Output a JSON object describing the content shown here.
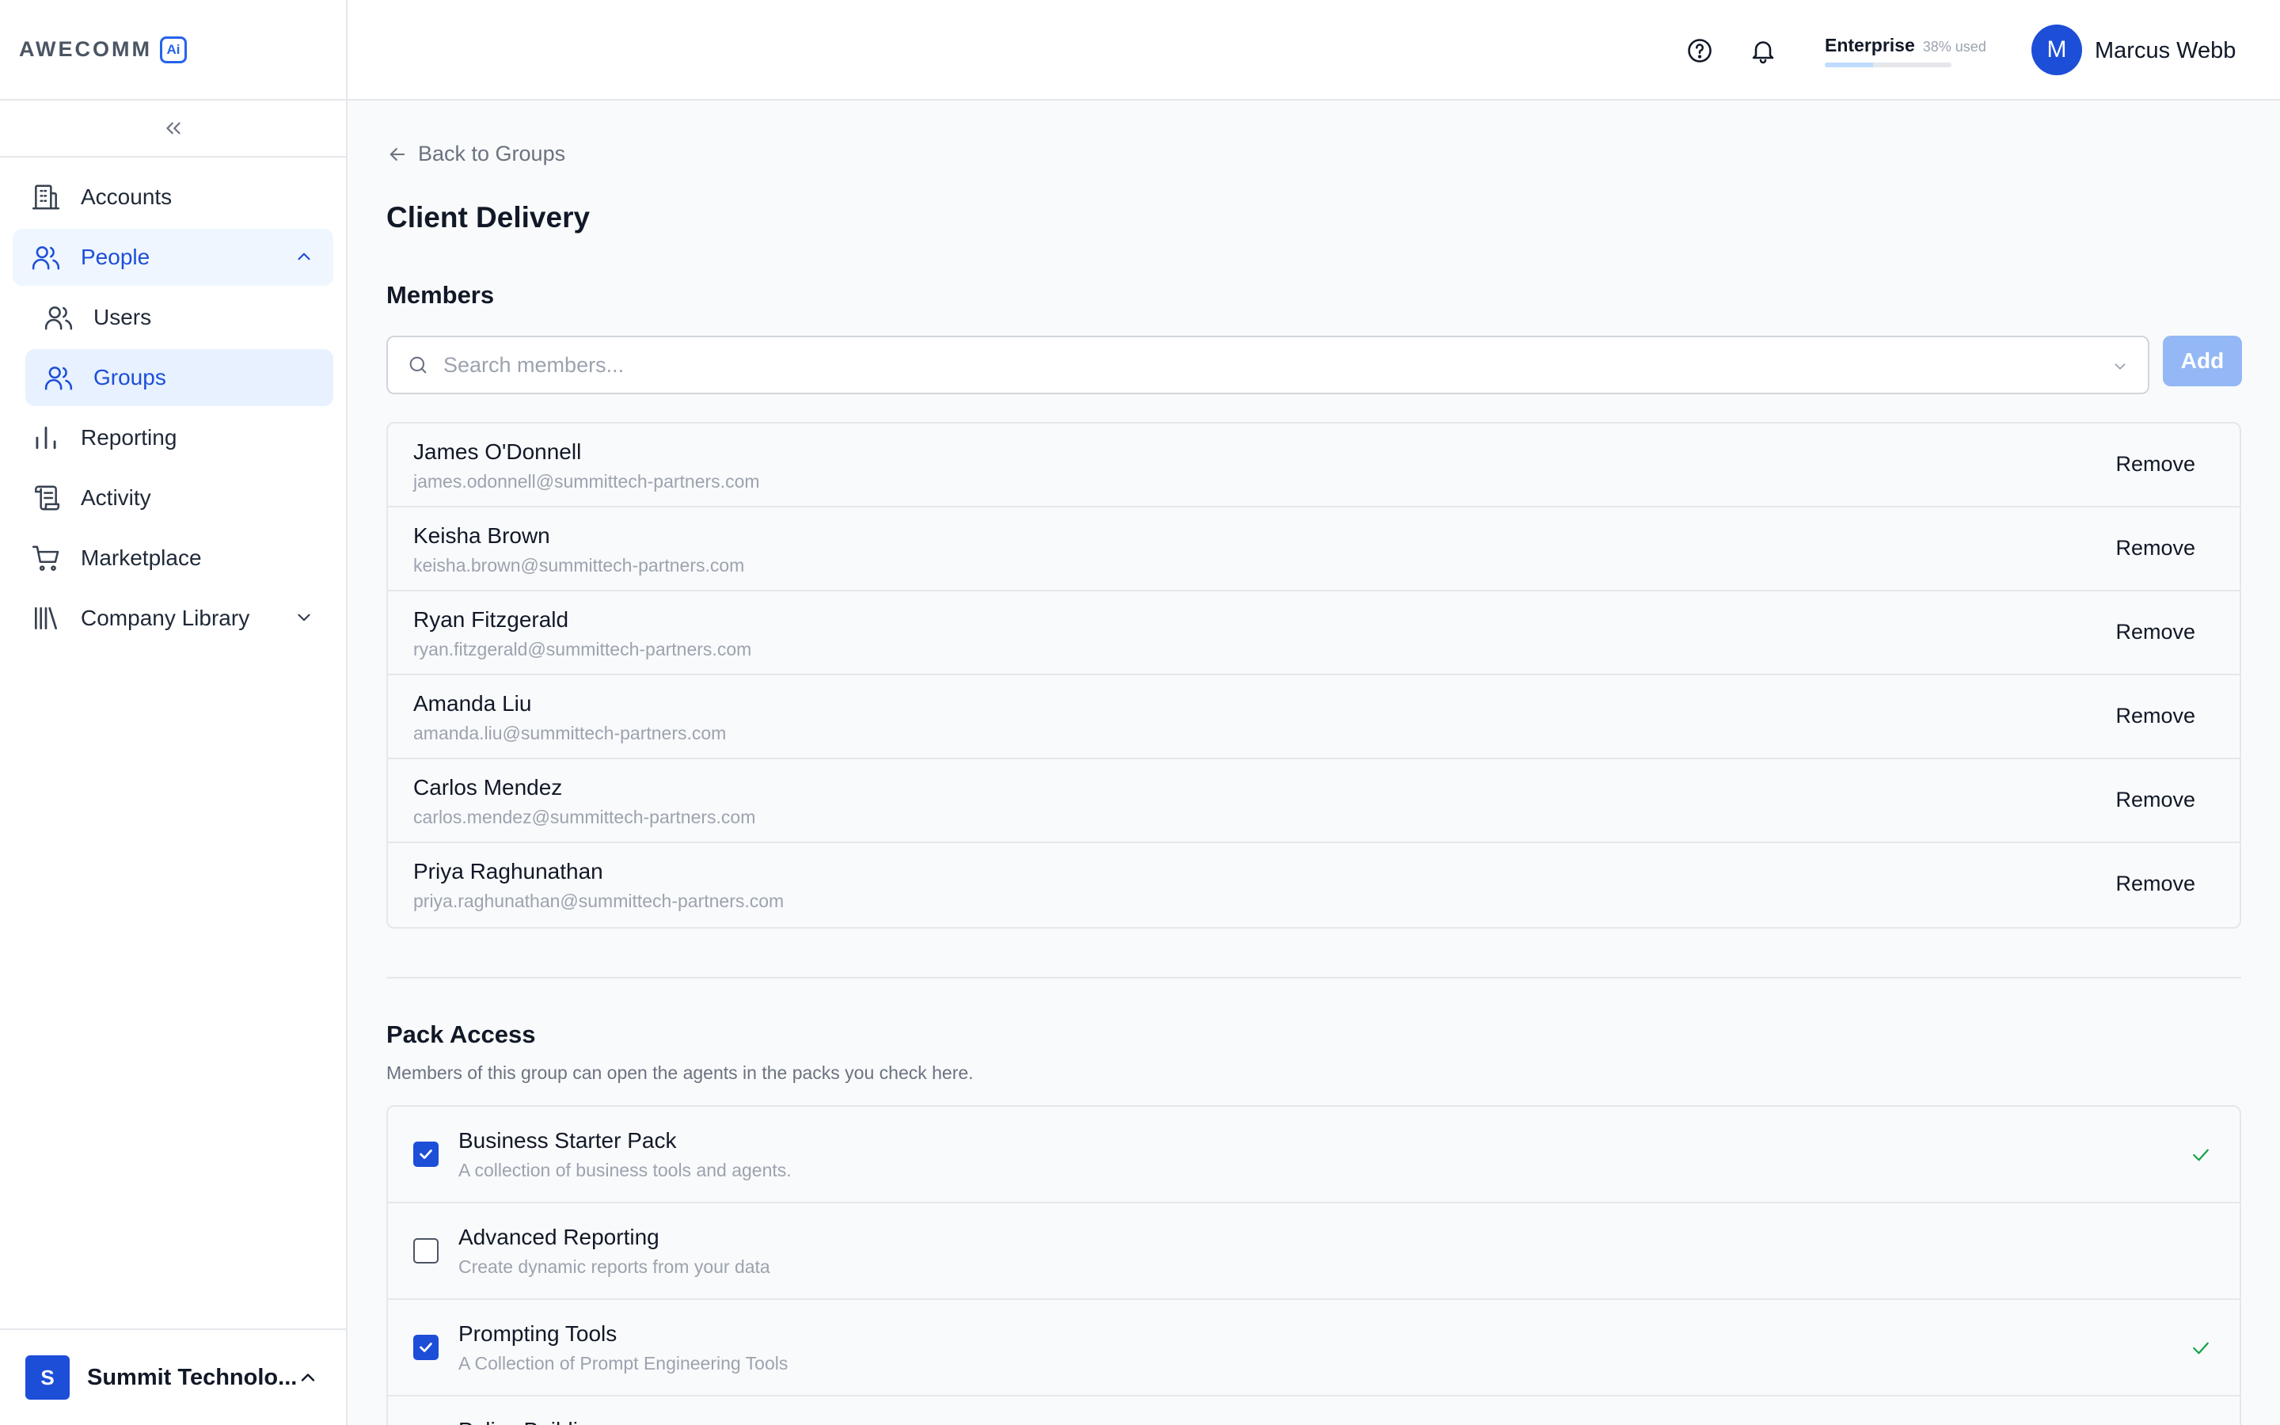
{
  "brand": {
    "name": "AWECOMM",
    "badge": "Ai"
  },
  "sidebar": {
    "items": [
      {
        "label": "Accounts"
      },
      {
        "label": "People"
      },
      {
        "label": "Users"
      },
      {
        "label": "Groups"
      },
      {
        "label": "Reporting"
      },
      {
        "label": "Activity"
      },
      {
        "label": "Marketplace"
      },
      {
        "label": "Company Library"
      }
    ],
    "org": {
      "initial": "S",
      "name": "Summit Technolo..."
    }
  },
  "header": {
    "plan": {
      "name": "Enterprise",
      "usage_text": "38% used",
      "usage_fraction": 0.38
    },
    "user": {
      "initial": "M",
      "name": "Marcus Webb"
    }
  },
  "main": {
    "back_label": "Back to Groups",
    "title": "Client Delivery",
    "members": {
      "title": "Members",
      "search_placeholder": "Search members...",
      "add_label": "Add",
      "remove_label": "Remove",
      "list": [
        {
          "name": "James O'Donnell",
          "email": "james.odonnell@summittech-partners.com"
        },
        {
          "name": "Keisha Brown",
          "email": "keisha.brown@summittech-partners.com"
        },
        {
          "name": "Ryan Fitzgerald",
          "email": "ryan.fitzgerald@summittech-partners.com"
        },
        {
          "name": "Amanda Liu",
          "email": "amanda.liu@summittech-partners.com"
        },
        {
          "name": "Carlos Mendez",
          "email": "carlos.mendez@summittech-partners.com"
        },
        {
          "name": "Priya Raghunathan",
          "email": "priya.raghunathan@summittech-partners.com"
        }
      ]
    },
    "pack_access": {
      "title": "Pack Access",
      "description": "Members of this group can open the agents in the packs you check here.",
      "packs": [
        {
          "name": "Business Starter Pack",
          "description": "A collection of business tools and agents.",
          "checked": true
        },
        {
          "name": "Advanced Reporting",
          "description": "Create dynamic reports from your data",
          "checked": false
        },
        {
          "name": "Prompting Tools",
          "description": "A Collection of Prompt Engineering Tools",
          "checked": true
        },
        {
          "name": "Policy Building",
          "description": "",
          "checked": false
        }
      ]
    }
  },
  "colors": {
    "accent": "#1d4ed8",
    "success": "#16a34a",
    "muted": "#9ca3af"
  }
}
